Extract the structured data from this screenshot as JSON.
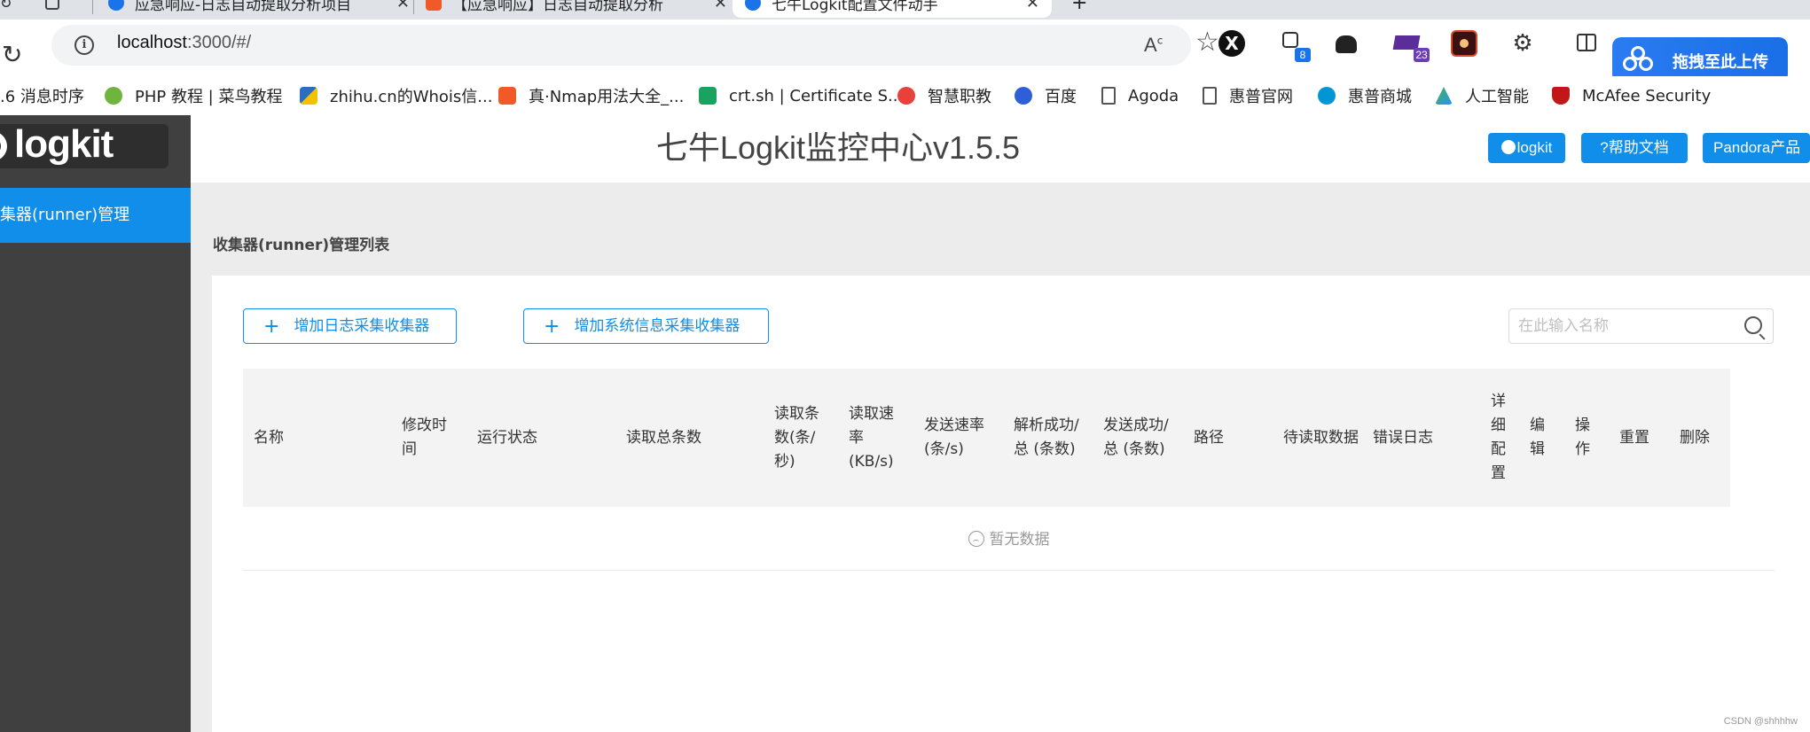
{
  "browser": {
    "tabs": [
      {
        "label": "应急响应-日志自动提取分析项目"
      },
      {
        "label": "【应急响应】日志自动提取分析"
      },
      {
        "label": "七牛Logkit配置文件动手",
        "active": true
      }
    ],
    "address": {
      "host": "localhost",
      "path": ":3000/#/"
    },
    "read_aloud_label": "A ʹ",
    "extensions": {
      "robot_badge": "8",
      "cap_badge": "23",
      "x_label": "X"
    },
    "upload_button": "拖拽至此上传",
    "bookmarks": [
      {
        "label": ".6 消息时序",
        "color": "#ffffff"
      },
      {
        "label": "PHP 教程 | 菜鸟教程",
        "color": "#6eb43f"
      },
      {
        "label": "zhihu.cn的Whois信...",
        "color": "#2a6fbf"
      },
      {
        "label": "真·Nmap用法大全_...",
        "color": "#f05a28"
      },
      {
        "label": "crt.sh | Certificate S...",
        "color": "#1aa260"
      },
      {
        "label": "智慧职教",
        "color": "#e8413c"
      },
      {
        "label": "百度",
        "color": "#2e5fd8"
      },
      {
        "label": "Agoda",
        "color": "#555555"
      },
      {
        "label": "惠普官网",
        "color": "#555555"
      },
      {
        "label": "惠普商城",
        "color": "#0096d6"
      },
      {
        "label": "人工智能",
        "color": "#4caf50"
      },
      {
        "label": "McAfee Security",
        "color": "#c01818"
      }
    ]
  },
  "sidebar": {
    "logo_text": "logkit",
    "menu": [
      {
        "label": "集器(runner)管理"
      }
    ]
  },
  "header": {
    "title": "七牛Logkit监控中心v1.5.5",
    "buttons": {
      "github": "logkit",
      "help": "?帮助文档",
      "pandora": "Pandora产品"
    }
  },
  "main": {
    "section_title": "收集器(runner)管理列表",
    "add_log_button": "增加日志采集收集器",
    "add_sys_button": "增加系统信息采集收集器",
    "search_placeholder": "在此输入名称",
    "columns": [
      "名称",
      "修改时间",
      "运行状态",
      "读取总条数",
      "读取条数(条/秒)",
      "读取速率(KB/s)",
      "发送速率(条/s)",
      "解析成功/总 (条数)",
      "发送成功/总 (条数)",
      "路径",
      "待读取数据",
      "错误日志",
      "详细配置",
      "编辑",
      "操作",
      "重置",
      "删除"
    ],
    "empty_text": "暂无数据"
  },
  "watermark": "CSDN @shhhhw",
  "colors": {
    "accent": "#108ee9",
    "sidebar": "#404040",
    "content_bg": "#ececec"
  }
}
